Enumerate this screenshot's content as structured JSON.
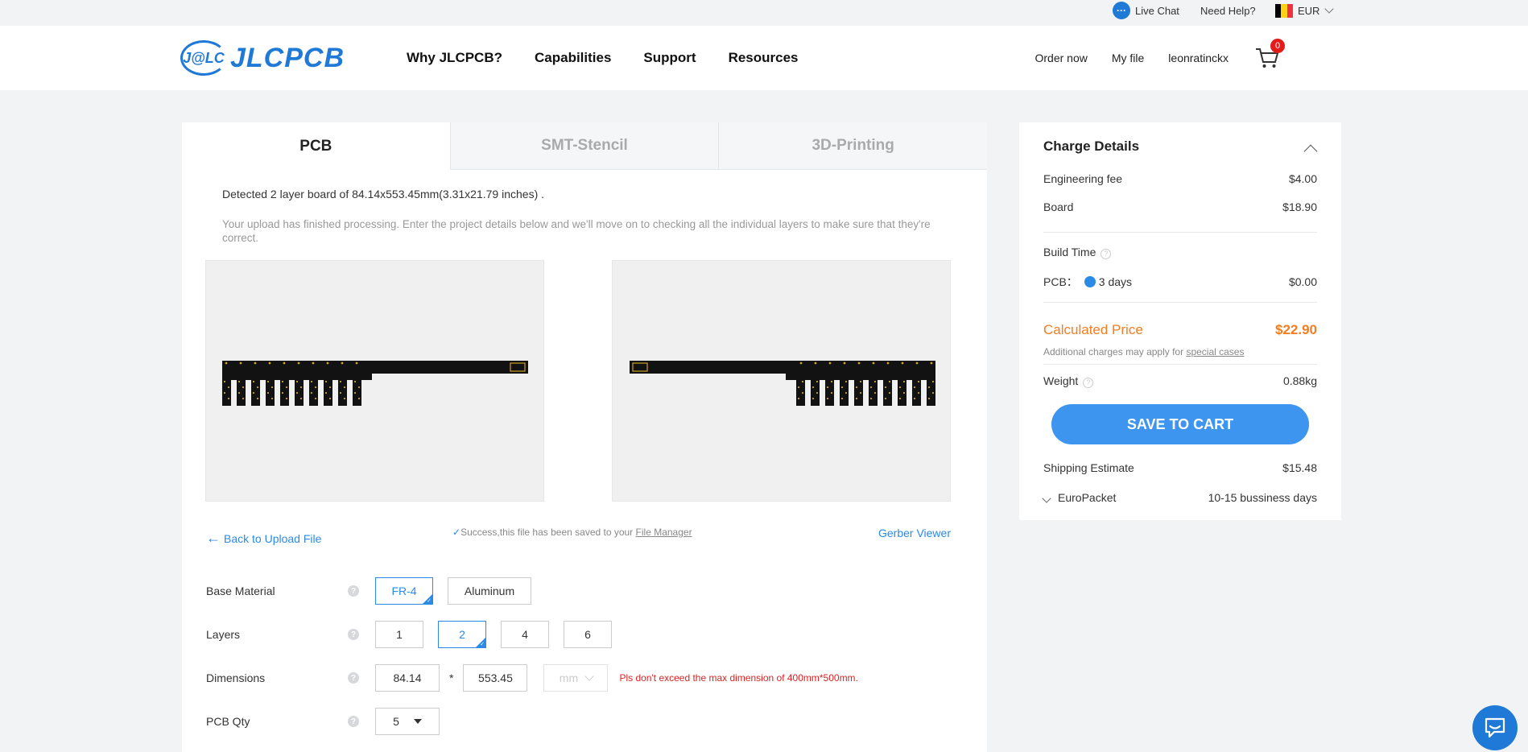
{
  "topbar": {
    "live_chat": "Live Chat",
    "need_help": "Need Help?",
    "currency": "EUR"
  },
  "header": {
    "logo_mark": "J@LC",
    "logo_text": "JLCPCB",
    "nav": [
      "Why JLCPCB?",
      "Capabilities",
      "Support",
      "Resources"
    ],
    "order_now": "Order now",
    "my_file": "My file",
    "username": "leonratinckx",
    "cart_count": "0"
  },
  "main": {
    "tabs": [
      "PCB",
      "SMT-Stencil",
      "3D-Printing"
    ],
    "detected": "Detected 2 layer board of 84.14x553.45mm(3.31x21.79 inches) .",
    "description": "Your upload has finished processing. Enter the project details below and we'll move on to checking all the individual layers to make sure that they're correct.",
    "back_link": "Back to Upload File",
    "success_text": "Success,this file has been saved to your",
    "file_manager": "File Manager",
    "gerber_viewer": "Gerber Viewer",
    "base_material": {
      "label": "Base Material",
      "options": [
        "FR-4",
        "Aluminum"
      ],
      "selected": "FR-4"
    },
    "layers": {
      "label": "Layers",
      "options": [
        "1",
        "2",
        "4",
        "6"
      ],
      "selected": "2"
    },
    "dimensions": {
      "label": "Dimensions",
      "width": "84.14",
      "height": "553.45",
      "unit": "mm",
      "warning": "Pls don't exceed the max dimension of 400mm*500mm."
    },
    "qty": {
      "label": "PCB Qty",
      "value": "5"
    }
  },
  "charges": {
    "title": "Charge Details",
    "engineering_fee_label": "Engineering fee",
    "engineering_fee": "$4.00",
    "board_label": "Board",
    "board": "$18.90",
    "build_time_label": "Build Time",
    "pcb_label": "PCB：",
    "pcb_days": "3 days",
    "pcb_cost": "$0.00",
    "calculated_label": "Calculated Price",
    "calculated_price": "$22.90",
    "note": "Additional charges may apply for",
    "note_link": "special cases",
    "weight_label": "Weight",
    "weight": "0.88kg",
    "save_button": "SAVE TO CART",
    "shipping_label": "Shipping Estimate",
    "shipping": "$15.48",
    "carrier": "EuroPacket",
    "delivery": "10-15 bussiness days"
  },
  "colors": {
    "brand": "#1f79d6",
    "accent": "#2b8ae6",
    "price": "#f57c1f",
    "warning": "#e02020",
    "board": "#121212",
    "pads": "#c9a227"
  }
}
